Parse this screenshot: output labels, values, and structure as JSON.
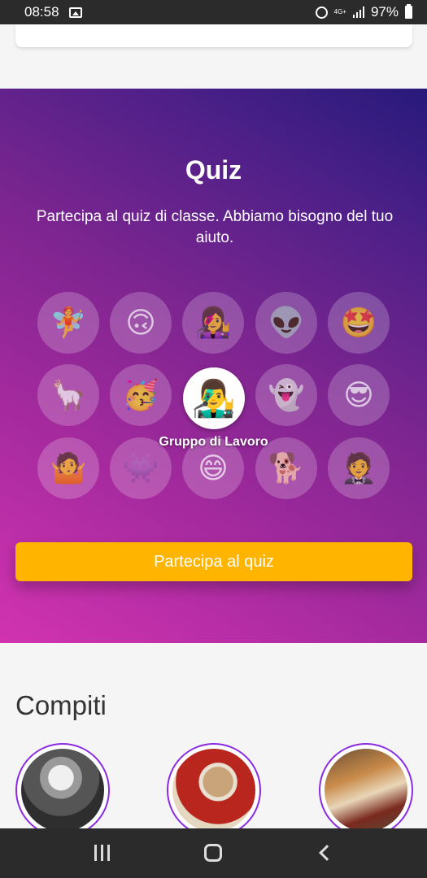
{
  "status_bar": {
    "time": "08:58",
    "network": "4G+",
    "battery": "97%",
    "icons": [
      "image-icon",
      "alarm-icon",
      "signal-icon",
      "battery-icon"
    ]
  },
  "quiz": {
    "title": "Quiz",
    "description": "Partecipa al quiz di classe. Abbiamo bisogno del tuo aiuto.",
    "avatars": [
      "🧚",
      "🙃",
      "👩‍🎤",
      "👽",
      "🤩",
      "🦙",
      "🥳",
      "👻",
      "😎",
      "🤷",
      "👾",
      "😄",
      "🐕",
      "🤵"
    ],
    "center_avatar": "👨‍🎤",
    "center_label": "Gruppo di Lavoro",
    "button_label": "Partecipa al quiz",
    "colors": {
      "button": "#ffb400",
      "gradient_start": "#d233b0",
      "gradient_end": "#271a7a"
    }
  },
  "compiti": {
    "title": "Compiti",
    "items": [
      "einstein-avatar",
      "dante-avatar",
      "napoleon-avatar"
    ],
    "colors": {
      "ring": "#8a2be2"
    }
  },
  "nav": {
    "icons": [
      "recents-icon",
      "home-icon",
      "back-icon"
    ]
  }
}
